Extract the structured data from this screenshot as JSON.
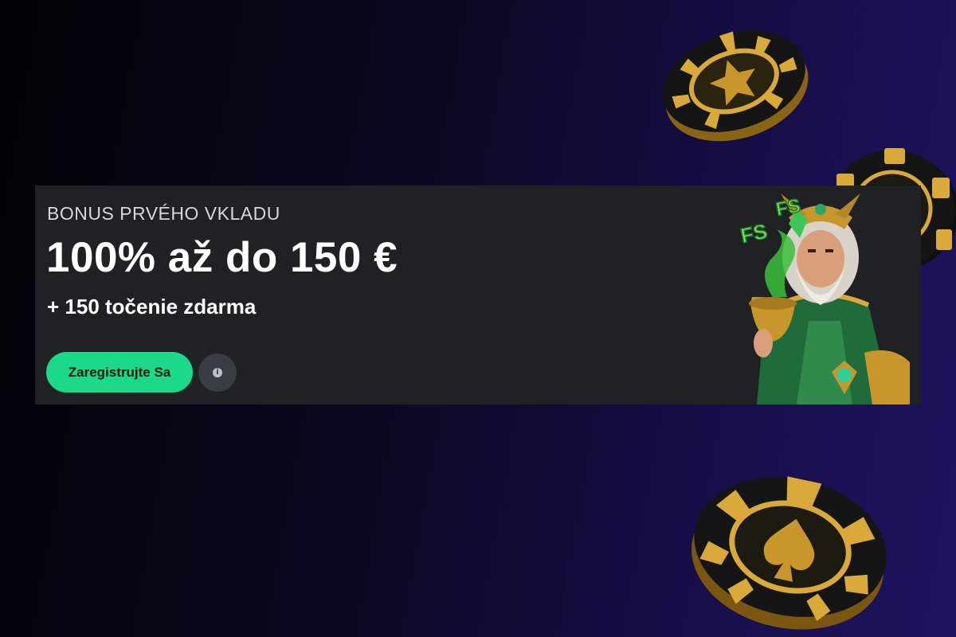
{
  "promo": {
    "subtitle": "BONUS PRVÉHO VKLADU",
    "headline": "100% až do 150 €",
    "free_spins": "+ 150 točenie zdarma",
    "cta_label": "Zaregistrujte Sa",
    "info_icon": "info-icon",
    "fs_badge_1": "FS",
    "fs_badge_2": "FS"
  },
  "colors": {
    "cta": "#1bd989",
    "banner_bg": "#1f2124",
    "chip_gold": "#d9a93a",
    "chip_black": "#151515",
    "bg_end": "#1e1460"
  },
  "decor": {
    "chips": [
      "star-chip-icon",
      "spade-chip-icon",
      "spade-chip-icon"
    ],
    "character": "wizard-character-illustration"
  }
}
